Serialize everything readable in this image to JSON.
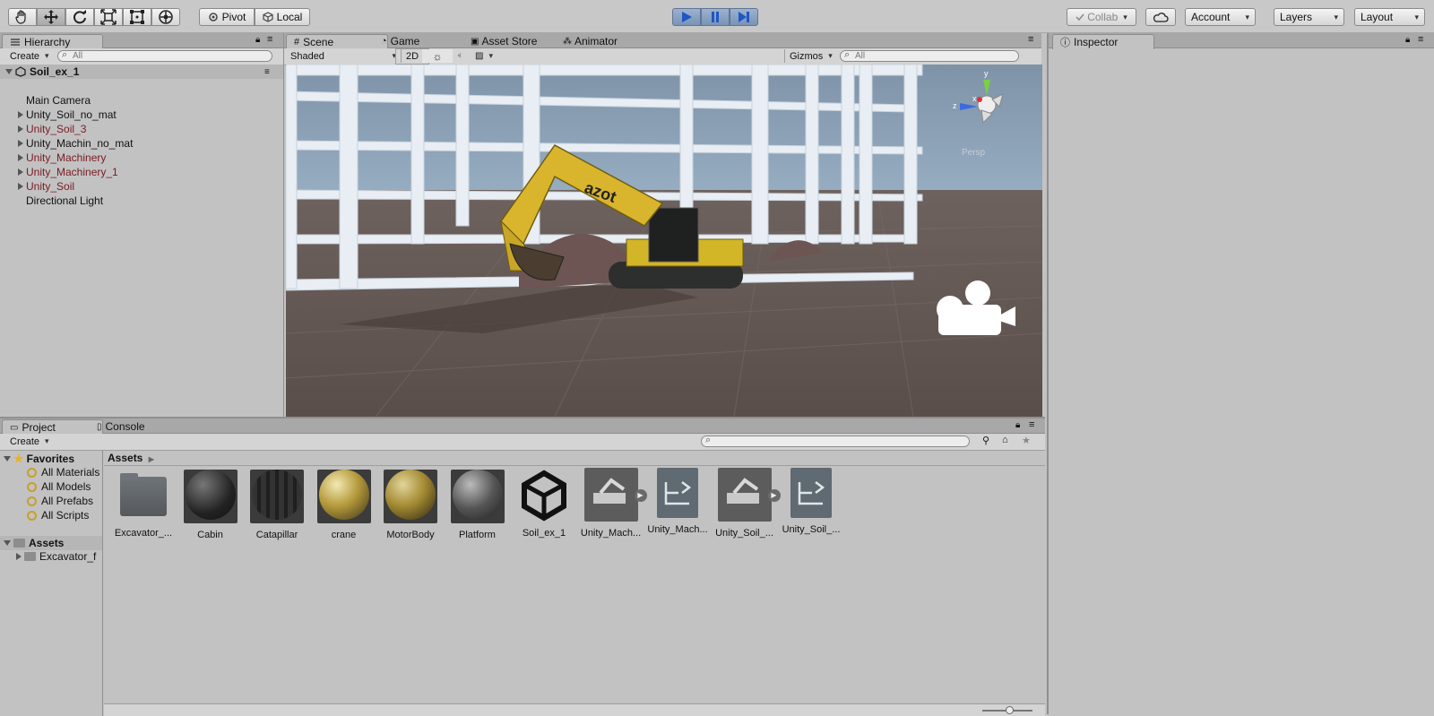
{
  "toolbar": {
    "tools": [
      "hand-tool",
      "move-tool",
      "rotate-tool",
      "scale-tool",
      "rect-tool",
      "transform-tool"
    ],
    "pivot_label": "Pivot",
    "local_label": "Local",
    "collab_label": "Collab",
    "account_label": "Account",
    "layers_label": "Layers",
    "layout_label": "Layout"
  },
  "hierarchy": {
    "tab_label": "Hierarchy",
    "create_label": "Create",
    "search_placeholder": "All",
    "scene_name": "Soil_ex_1",
    "items": [
      {
        "label": "Main Camera",
        "expandable": false,
        "prefab": false
      },
      {
        "label": "Unity_Soil_no_mat",
        "expandable": true,
        "prefab": false
      },
      {
        "label": "Unity_Soil_3",
        "expandable": true,
        "prefab": true
      },
      {
        "label": "Unity_Machin_no_mat",
        "expandable": true,
        "prefab": false
      },
      {
        "label": "Unity_Machinery",
        "expandable": true,
        "prefab": true
      },
      {
        "label": "Unity_Machinery_1",
        "expandable": true,
        "prefab": true
      },
      {
        "label": "Unity_Soil",
        "expandable": true,
        "prefab": true
      },
      {
        "label": "Directional Light",
        "expandable": false,
        "prefab": false
      }
    ]
  },
  "scene": {
    "tabs": [
      "Scene",
      "Game",
      "Asset Store",
      "Animator"
    ],
    "shading_mode": "Shaded",
    "mode_2d": "2D",
    "gizmos_label": "Gizmos",
    "search_placeholder": "All",
    "persp_label": "Persp",
    "axis_labels": {
      "y": "y",
      "x": "x",
      "z": "z"
    },
    "excavator_text": "azot"
  },
  "inspector": {
    "tab_label": "Inspector"
  },
  "project": {
    "tabs": [
      "Project",
      "Console"
    ],
    "create_label": "Create",
    "favorites_label": "Favorites",
    "favorites": [
      "All Materials",
      "All Models",
      "All Prefabs",
      "All Scripts"
    ],
    "assets_root": "Assets",
    "asset_folders": [
      "Excavator_f"
    ],
    "breadcrumb": "Assets",
    "assets": [
      {
        "label": "Excavator_...",
        "kind": "folder"
      },
      {
        "label": "Cabin",
        "kind": "material"
      },
      {
        "label": "Catapillar",
        "kind": "material"
      },
      {
        "label": "crane",
        "kind": "material"
      },
      {
        "label": "MotorBody",
        "kind": "material"
      },
      {
        "label": "Platform",
        "kind": "material"
      },
      {
        "label": "Soil_ex_1",
        "kind": "scene"
      },
      {
        "label": "Unity_Mach...",
        "kind": "model"
      },
      {
        "label": "Unity_Mach...",
        "kind": "prefab"
      },
      {
        "label": "Unity_Soil_...",
        "kind": "model"
      },
      {
        "label": "Unity_Soil_...",
        "kind": "prefab"
      }
    ]
  },
  "colors": {
    "accent_play": "#7a93b5",
    "prefab_text": "#7a1b24",
    "panel_bg": "#c2c2c2"
  }
}
